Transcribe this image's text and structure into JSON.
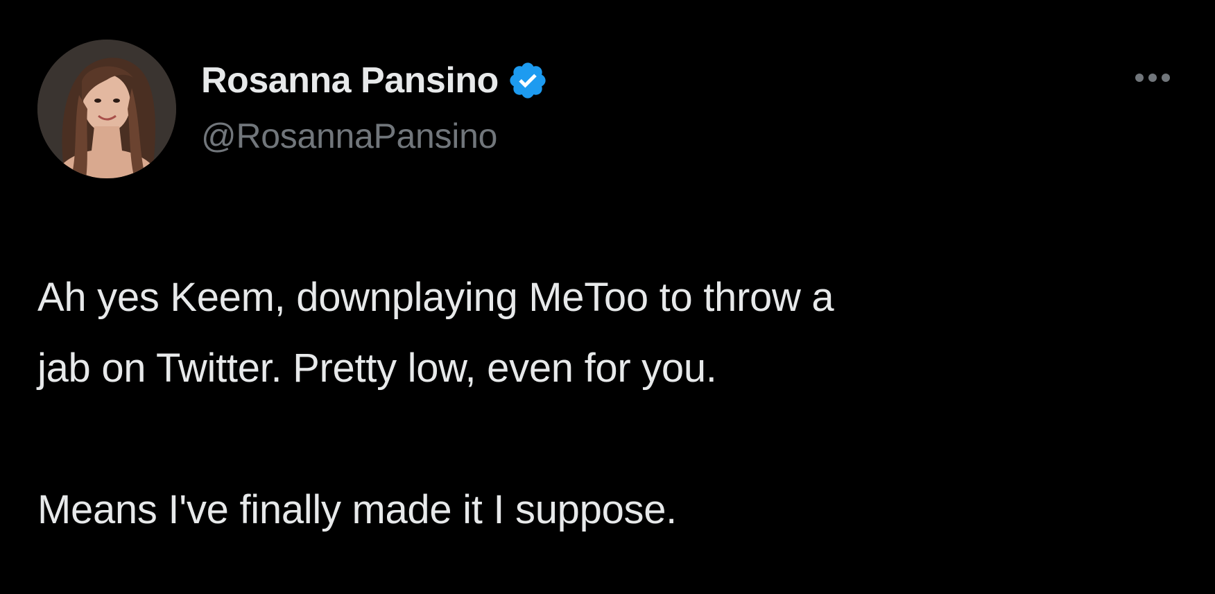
{
  "author": {
    "display_name": "Rosanna Pansino",
    "handle": "@RosannaPansino",
    "verified": true,
    "verified_badge_icon": "verified-checkmark-icon",
    "badge_color": "#1d9bf0",
    "avatar_icon": "profile-photo"
  },
  "menu": {
    "icon": "more-options-icon"
  },
  "tweet": {
    "lines_paragraph1": [
      "Ah yes Keem, downplaying MeToo to throw a",
      "jab on Twitter. Pretty low, even for you."
    ],
    "line_paragraph2": "Means I've finally made it I suppose."
  },
  "colors": {
    "background": "#000000",
    "primary_text": "#e7e9ea",
    "secondary_text": "#71767b"
  }
}
